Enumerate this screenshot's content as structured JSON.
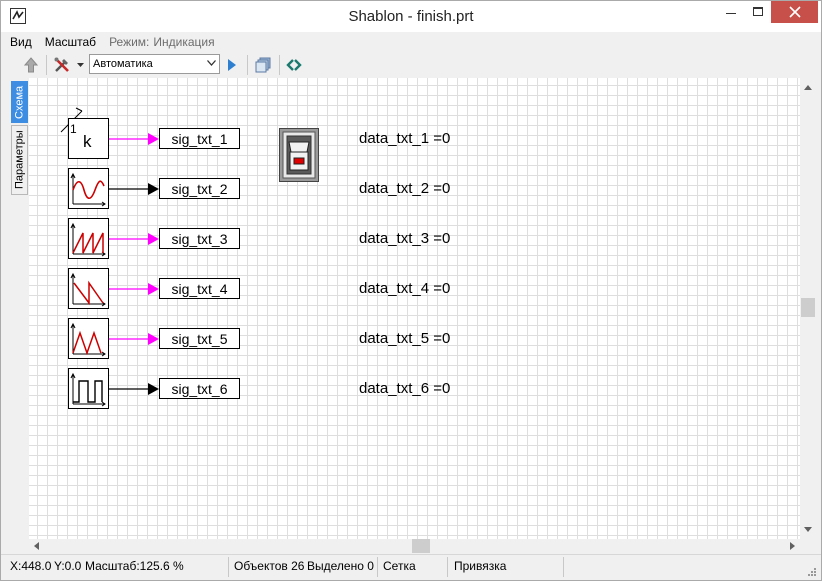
{
  "window": {
    "title": "Shablon - finish.prt"
  },
  "menu": {
    "view": "Вид",
    "scale": "Масштаб",
    "mode_label": "Режим:",
    "mode_value": "Индикация"
  },
  "toolbar": {
    "mode_select": "Автоматика"
  },
  "sidetabs": {
    "scheme": "Схема",
    "params": "Параметры"
  },
  "canvas": {
    "counter_block": {
      "preset": "1",
      "symbol": "k"
    },
    "signals": [
      {
        "label": "sig_txt_1",
        "wire_color": "#ff00ff",
        "icon": "counter-icon"
      },
      {
        "label": "sig_txt_2",
        "wire_color": "#000000",
        "icon": "sine-wave-icon"
      },
      {
        "label": "sig_txt_3",
        "wire_color": "#ff00ff",
        "icon": "sawtooth-rising-icon"
      },
      {
        "label": "sig_txt_4",
        "wire_color": "#ff00ff",
        "icon": "sawtooth-falling-icon"
      },
      {
        "label": "sig_txt_5",
        "wire_color": "#ff00ff",
        "icon": "triangle-wave-icon"
      },
      {
        "label": "sig_txt_6",
        "wire_color": "#000000",
        "icon": "square-wave-icon"
      }
    ],
    "data_lines": [
      "data_txt_1 =0",
      "data_txt_2 =0",
      "data_txt_3 =0",
      "data_txt_4 =0",
      "data_txt_5 =0",
      "data_txt_6 =0"
    ]
  },
  "status": {
    "x": "X:448.0",
    "y": "Y:0.0",
    "scale": "Масштаб:125.6 %",
    "objects": "Объектов 26",
    "selected": "Выделено 0",
    "grid": "Сетка",
    "snap": "Привязка"
  },
  "colors": {
    "accent_tab": "#3d8ee3",
    "close_button": "#c7504a",
    "wave": "#cc0000",
    "switch_red": "#e00000"
  }
}
